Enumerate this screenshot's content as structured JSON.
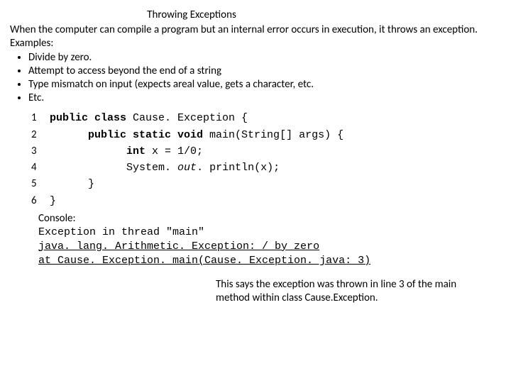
{
  "title": "Throwing Exceptions",
  "intro": "When the computer can compile a program but an internal error occurs in execution, it throws an exception.",
  "examples_label": "Examples:",
  "bullets": [
    "Divide by zero.",
    "Attempt to access beyond the end of a string",
    "Type mismatch on input (expects areal value, gets a character, etc.",
    "Etc."
  ],
  "code": {
    "lines": [
      {
        "n": "1",
        "pre": "",
        "kw": "public class ",
        "plain1": "Cause. Exception {",
        "post": ""
      },
      {
        "n": "2",
        "pre": "      ",
        "kw": "public static void ",
        "plain1": "main(String[] args) {",
        "post": ""
      },
      {
        "n": "3",
        "pre": "            ",
        "kw": "int ",
        "plain1": "x = 1/0;",
        "post": ""
      },
      {
        "n": "4",
        "pre": "            ",
        "plain1": "System. ",
        "ital": "out",
        "plain2": ". println(x);"
      },
      {
        "n": "5",
        "pre": "      ",
        "plain1": "}"
      },
      {
        "n": "6",
        "pre": "",
        "plain1": "}"
      }
    ]
  },
  "console": {
    "label": "Console:",
    "line1": "Exception in thread \"main\"",
    "line2": "java. lang. Arithmetic. Exception: / by zero",
    "line3": "at Cause. Exception. main(Cause. Exception. java: 3)"
  },
  "caption": "This says the exception was thrown in line 3 of the main method within class Cause.Exception."
}
